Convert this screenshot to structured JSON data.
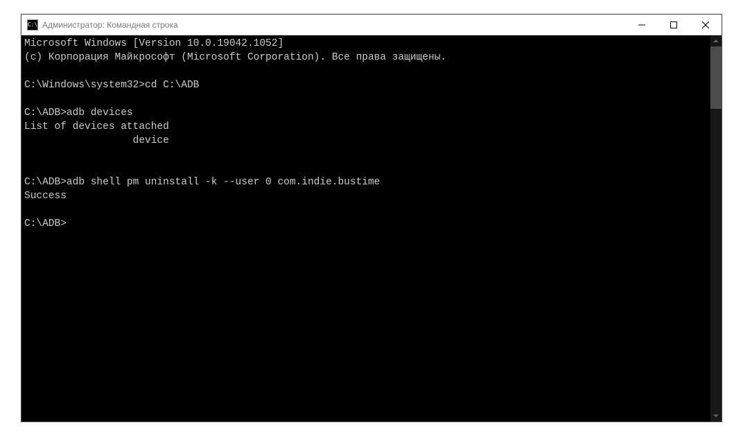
{
  "window": {
    "title": "Администратор: Командная строка",
    "icon_text": "C:\\"
  },
  "terminal": {
    "lines": [
      "Microsoft Windows [Version 10.0.19042.1052]",
      "(c) Корпорация Майкрософт (Microsoft Corporation). Все права защищены.",
      "",
      "C:\\Windows\\system32>cd C:\\ADB",
      "",
      "C:\\ADB>adb devices",
      "List of devices attached",
      "                  device",
      "",
      "",
      "C:\\ADB>adb shell pm uninstall -k --user 0 com.indie.bustime",
      "Success",
      "",
      "C:\\ADB>"
    ]
  }
}
